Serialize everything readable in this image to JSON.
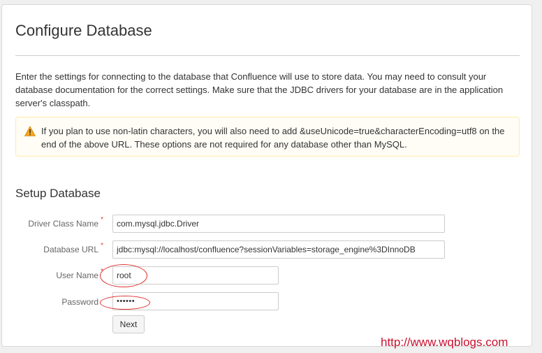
{
  "page": {
    "title": "Configure Database",
    "intro": "Enter the settings for connecting to the database that Confluence will use to store data. You may need to consult your database documentation for the correct settings. Make sure that the JDBC drivers for your database are in the application server's classpath.",
    "warning": {
      "icon": "warning-triangle-icon",
      "text": "If you plan to use non-latin characters, you will also need to add &useUnicode=true&characterEncoding=utf8 on the end of the above URL. These options are not required for any database other than MySQL."
    },
    "section_title": "Setup Database",
    "form": {
      "driver_class": {
        "label": "Driver Class Name",
        "required": "*",
        "value": "com.mysql.jdbc.Driver"
      },
      "database_url": {
        "label": "Database URL",
        "required": "*",
        "value": "jdbc:mysql://localhost/confluence?sessionVariables=storage_engine%3DInnoDB"
      },
      "user_name": {
        "label": "User Name",
        "required": "*",
        "value": "root"
      },
      "password": {
        "label": "Password",
        "value": "••••••"
      },
      "next_label": "Next"
    },
    "colors": {
      "annotation": "#e0312f",
      "watermark": "#c8102e",
      "warning_icon": "#f5a623"
    }
  },
  "watermark": "http://www.wqblogs.com"
}
